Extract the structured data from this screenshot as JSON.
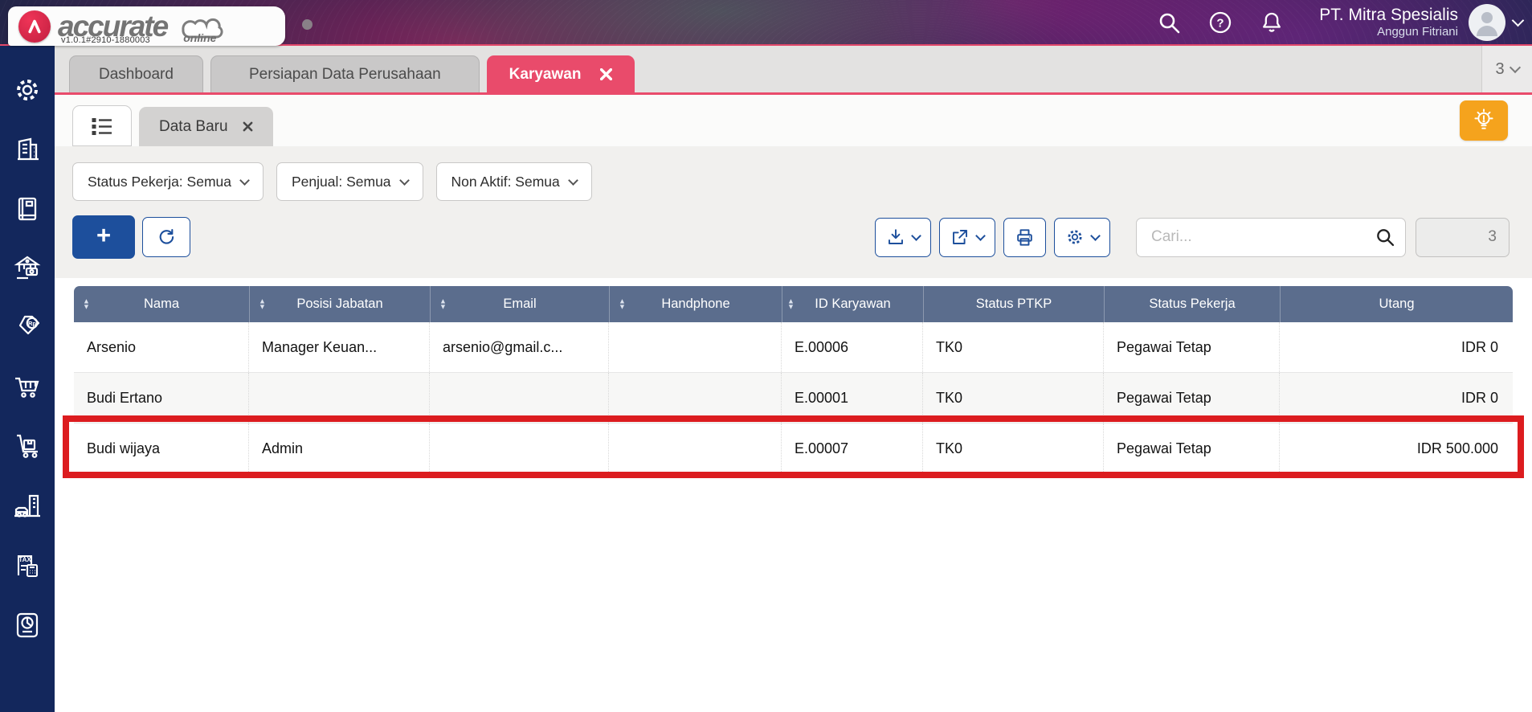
{
  "colors": {
    "header_bg": "#1c2547",
    "sidebar_bg": "#13275c",
    "active_tab_pink": "#e94b6b",
    "accent_blue": "#1d4f9c",
    "table_header_bg": "#5b6d8d",
    "annotation_red": "#dc1c1f",
    "lightbulb_orange": "#f5a31d",
    "logo_red": "#d6243f"
  },
  "header": {
    "brand_name": "accurate",
    "brand_sub": "online",
    "version": "v1.0.1#2910-1880003",
    "company_name": "PT. Mitra Spesialis",
    "user_name": "Anggun Fitriani"
  },
  "tab_bar": {
    "tabs": [
      {
        "label": "Dashboard",
        "active": false
      },
      {
        "label": "Persiapan Data Perusahaan",
        "active": false
      },
      {
        "label": "Karyawan",
        "active": true,
        "closable": true
      }
    ],
    "open_tab_count": "3"
  },
  "sub_tab_bar": {
    "active_tab_label": "Data Baru"
  },
  "filters": [
    {
      "label": "Status Pekerja: Semua"
    },
    {
      "label": "Penjual: Semua"
    },
    {
      "label": "Non Aktif: Semua"
    }
  ],
  "toolbar": {
    "add_label": "+",
    "search_placeholder": "Cari...",
    "search_value": "",
    "record_count": "3"
  },
  "table": {
    "columns": [
      {
        "label": "Nama",
        "sortable": true
      },
      {
        "label": "Posisi Jabatan",
        "sortable": true
      },
      {
        "label": "Email",
        "sortable": true
      },
      {
        "label": "Handphone",
        "sortable": true
      },
      {
        "label": "ID Karyawan",
        "sortable": true
      },
      {
        "label": "Status PTKP",
        "sortable": false
      },
      {
        "label": "Status Pekerja",
        "sortable": false
      },
      {
        "label": "Utang",
        "sortable": false
      }
    ],
    "rows": [
      {
        "highlighted": false,
        "cells": [
          "Arsenio",
          "Manager Keuan...",
          "arsenio@gmail.c...",
          "",
          "E.00006",
          "TK0",
          "Pegawai Tetap",
          "IDR 0"
        ]
      },
      {
        "highlighted": false,
        "cells": [
          "Budi Ertano",
          "",
          "",
          "",
          "E.00001",
          "TK0",
          "Pegawai Tetap",
          "IDR 0"
        ]
      },
      {
        "highlighted": true,
        "cells": [
          "Budi wijaya",
          "Admin",
          "",
          "",
          "E.00007",
          "TK0",
          "Pegawai Tetap",
          "IDR 500.000"
        ]
      }
    ]
  },
  "sidebar": {
    "icons": [
      "settings",
      "company",
      "journal",
      "cash-bank",
      "sales-tag-rp",
      "purchase-cart",
      "inventory-trolley",
      "fixed-assets",
      "tax",
      "reports"
    ]
  },
  "header_icons": [
    "search",
    "help",
    "notifications"
  ]
}
